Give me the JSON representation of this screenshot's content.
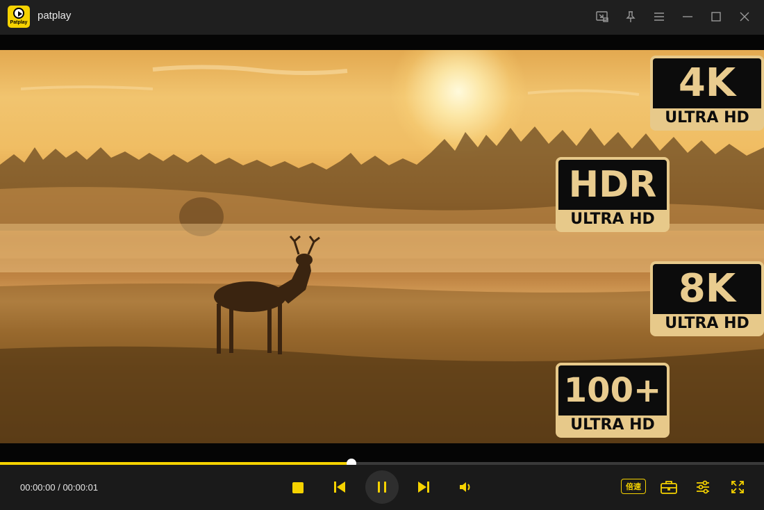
{
  "window": {
    "app_title": "patplay",
    "logo_text": "Patplay",
    "buttons": [
      "cast-icon",
      "pin-icon",
      "menu-icon",
      "minimize-icon",
      "maximize-icon",
      "close-icon"
    ]
  },
  "badges": [
    {
      "top": "4K",
      "bottom": "ULTRA HD"
    },
    {
      "top": "HDR",
      "bottom": "ULTRA HD"
    },
    {
      "top": "8K",
      "bottom": "ULTRA HD"
    },
    {
      "top": "100+",
      "bottom": "ULTRA HD"
    }
  ],
  "playback": {
    "current_time": "00:00:00",
    "total_time": "00:00:01",
    "time_display": "00:00:00 / 00:00:01",
    "progress": 0.46,
    "speed_label": "倍速"
  },
  "colors": {
    "accent": "#f5d200",
    "badge_gold": "#e7c98a",
    "background": "#1a1a1a"
  }
}
